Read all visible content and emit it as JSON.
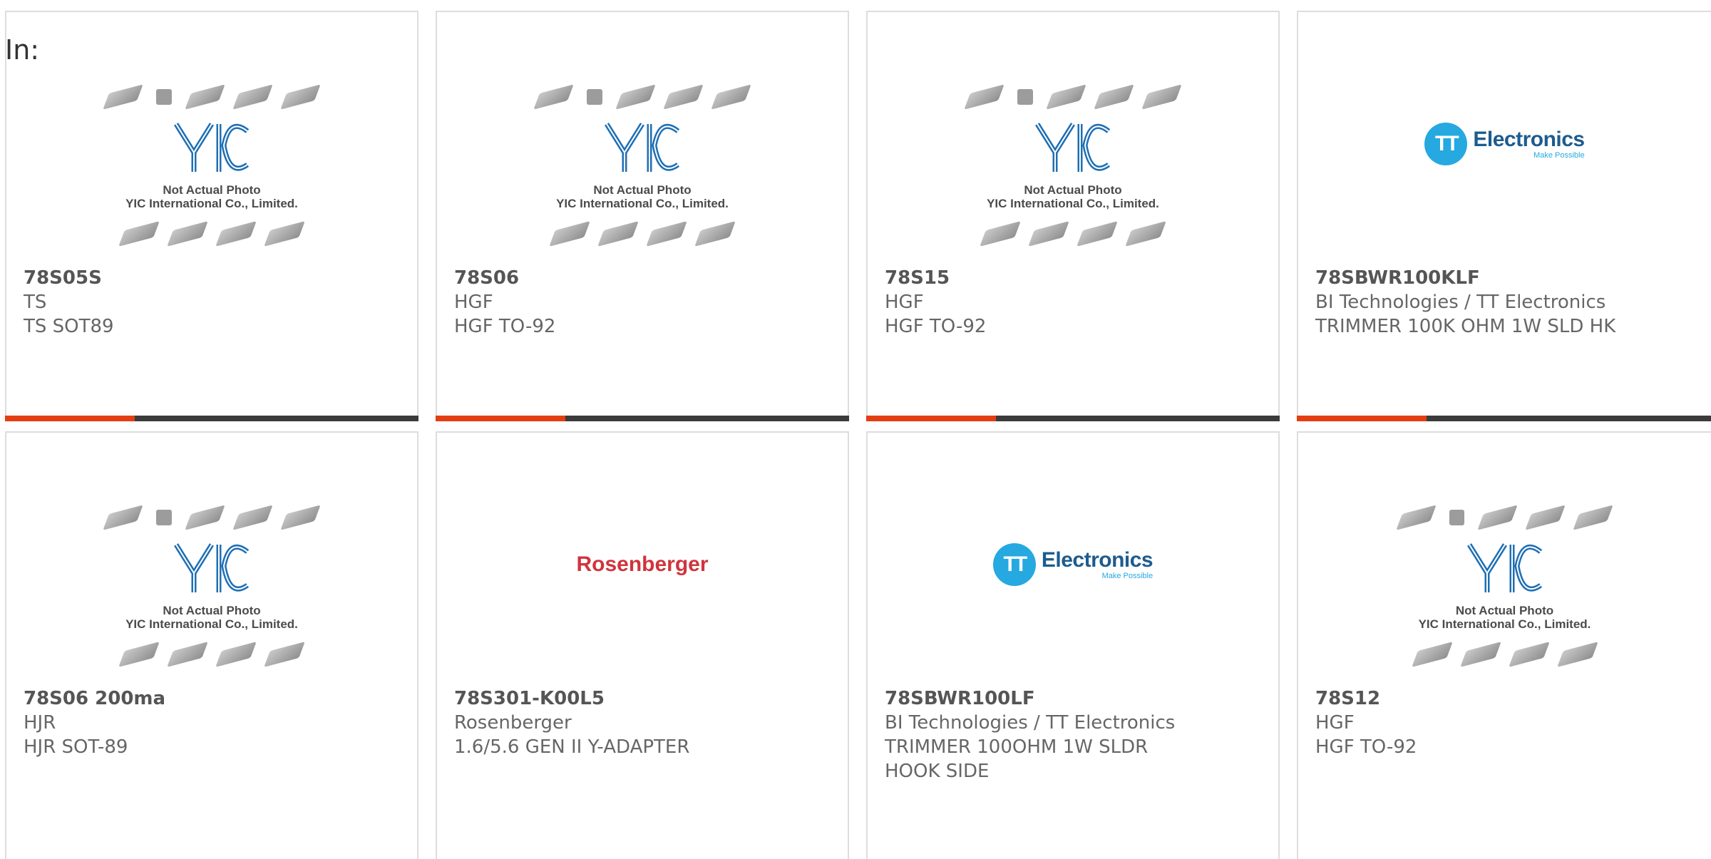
{
  "header": {
    "in_label": "In:"
  },
  "placeholder": {
    "line1": "Not Actual Photo",
    "line2": "YIC International Co., Limited."
  },
  "logos": {
    "tt_word": "Electronics",
    "tt_mark": "TT",
    "tt_tagline": "Make Possible",
    "rosenberger": "Rosenberger"
  },
  "colors": {
    "accent": "#e33e12",
    "bar": "#3b3b3b",
    "tt_blue": "#25a9e0",
    "rosenberger_red": "#d0343d",
    "yic_blue": "#1f6fb4"
  },
  "products": [
    {
      "part": "78S05S",
      "manufacturer": "TS",
      "description": "TS SOT89",
      "image": "placeholder"
    },
    {
      "part": "78S06",
      "manufacturer": "HGF",
      "description": "HGF TO-92",
      "image": "placeholder"
    },
    {
      "part": "78S15",
      "manufacturer": "HGF",
      "description": "HGF TO-92",
      "image": "placeholder"
    },
    {
      "part": "78SBWR100KLF",
      "manufacturer": "BI Technologies / TT Electronics",
      "description": "TRIMMER 100K OHM 1W SLD HK",
      "image": "tt-electronics-logo"
    },
    {
      "part": "78S06 200ma",
      "manufacturer": "HJR",
      "description": "HJR SOT-89",
      "image": "placeholder"
    },
    {
      "part": "78S301-K00L5",
      "manufacturer": "Rosenberger",
      "description": "1.6/5.6 GEN II Y-ADAPTER",
      "image": "rosenberger-logo"
    },
    {
      "part": "78SBWR100LF",
      "manufacturer": "BI Technologies / TT Electronics",
      "description": "TRIMMER 100OHM 1W SLDR\nHOOK SIDE",
      "image": "tt-electronics-logo"
    },
    {
      "part": "78S12",
      "manufacturer": "HGF",
      "description": "HGF TO-92",
      "image": "placeholder"
    }
  ]
}
